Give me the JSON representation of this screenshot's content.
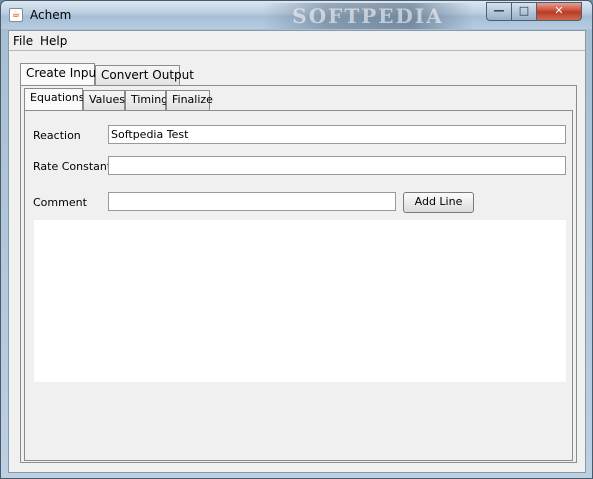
{
  "window": {
    "title": "Achem",
    "watermark": "SOFTPEDIA"
  },
  "titlebar_controls": {
    "minimize": "—",
    "maximize": "□",
    "close": "✕"
  },
  "menubar": {
    "items": [
      "File",
      "Help"
    ]
  },
  "outer_tabs": [
    "Create Input",
    "Convert Output"
  ],
  "inner_tabs": [
    "Equations",
    "Values",
    "Timing",
    "Finalize"
  ],
  "form": {
    "reaction_label": "Reaction",
    "reaction_value": "Softpedia Test",
    "rate_constant_label": "Rate Constant",
    "rate_constant_value": "",
    "comment_label": "Comment",
    "comment_value": "",
    "add_line_label": "Add Line"
  },
  "colors": {
    "panel": "#f0f0f0",
    "field_bg": "#ffffff",
    "close_button": "#c7452e"
  }
}
